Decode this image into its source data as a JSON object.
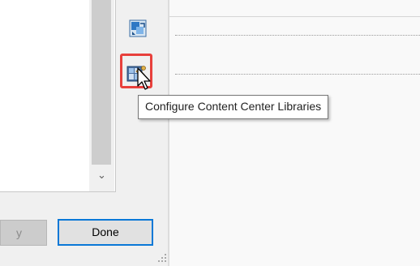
{
  "list_panel": {
    "scroll_down_glyph": "⌄"
  },
  "toolbar": {
    "top_button_icon": "place-from-content-center-icon",
    "config_button_icon": "configure-libraries-icon"
  },
  "tooltip": {
    "text": "Configure Content Center Libraries"
  },
  "footer": {
    "apply_label_partial": "y",
    "done_label": "Done"
  },
  "colors": {
    "highlight": "#e8403c",
    "focus_border": "#0a78d7"
  }
}
